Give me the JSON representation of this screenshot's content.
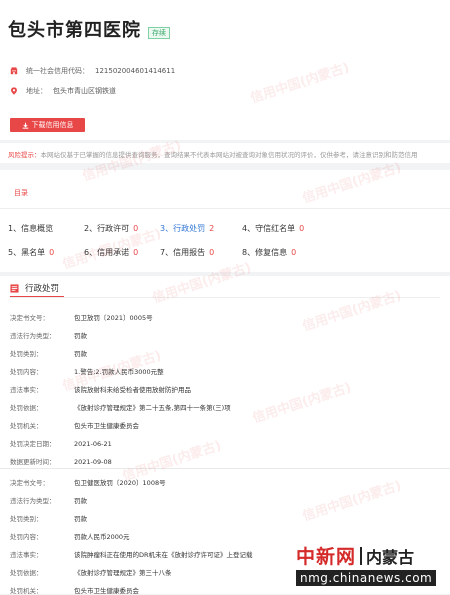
{
  "company": {
    "name": "包头市第四医院",
    "status_tag": "存续",
    "credit_code_label": "统一社会信用代码：",
    "credit_code": "121502004601414611",
    "address_label": "地址：",
    "address": "包头市青山区钢铁道",
    "download_label": "下载信用信息"
  },
  "risk": {
    "label": "风险提示：",
    "text": "本网站仅基于已掌握的信息提供查询服务，查询结果不代表本网站对被查询对象信用状况的评价，仅供参考，请注意识别和防范信用"
  },
  "toc": {
    "title": "目录",
    "items": [
      {
        "label": "1、信息概览",
        "count": ""
      },
      {
        "label": "2、行政许可",
        "count": "0"
      },
      {
        "label": "3、行政处罚",
        "count": "2"
      },
      {
        "label": "4、守信红名单",
        "count": "0"
      },
      {
        "label": "5、黑名单",
        "count": "0"
      },
      {
        "label": "6、信用承诺",
        "count": "0"
      },
      {
        "label": "7、信用报告",
        "count": "0"
      },
      {
        "label": "8、修复信息",
        "count": "0"
      }
    ]
  },
  "penalties": {
    "title": "行政处罚",
    "records": [
      {
        "rows": [
          {
            "k": "决定书文号：",
            "v": "包卫放罚〔2021〕0005号"
          },
          {
            "k": "违法行为类型：",
            "v": "罚款"
          },
          {
            "k": "处罚类别：",
            "v": "罚款"
          },
          {
            "k": "处罚内容：",
            "v": "1.警告;2.罚款人民币3000元整"
          },
          {
            "k": "违法事实：",
            "v": "该院放射科未给受检者使用放射防护用品"
          },
          {
            "k": "处罚依据：",
            "v": "《放射诊疗管理规定》第二十五条,第四十一条第(三)项"
          },
          {
            "k": "处罚机关：",
            "v": "包头市卫生健康委员会"
          },
          {
            "k": "处罚决定日期：",
            "v": "2021-06-21"
          },
          {
            "k": "数据更新时间：",
            "v": "2021-09-08"
          }
        ]
      },
      {
        "rows": [
          {
            "k": "决定书文号：",
            "v": "包卫健医放罚〔2020〕1008号"
          },
          {
            "k": "违法行为类型：",
            "v": "罚款"
          },
          {
            "k": "处罚类别：",
            "v": "罚款"
          },
          {
            "k": "处罚内容：",
            "v": "罚款人民币2000元"
          },
          {
            "k": "违法事实：",
            "v": "该院肿瘤科正在使用的DR机未在《放射诊疗许可证》上登记载"
          },
          {
            "k": "处罚依据：",
            "v": "《放射诊疗管理规定》第三十八条"
          },
          {
            "k": "处罚机关：",
            "v": "包头市卫生健康委员会"
          }
        ]
      }
    ]
  },
  "watermark": "信用中国(内蒙古)",
  "logo": {
    "cn": "中新网",
    "region": "内蒙古",
    "url": "nmg.chinanews.com"
  },
  "colors": {
    "accent": "#e84747",
    "active_link": "#3176d4",
    "tag_green": "#37a66a"
  },
  "icons": [
    "building-icon",
    "location-pin-icon",
    "download-icon",
    "document-list-icon"
  ]
}
